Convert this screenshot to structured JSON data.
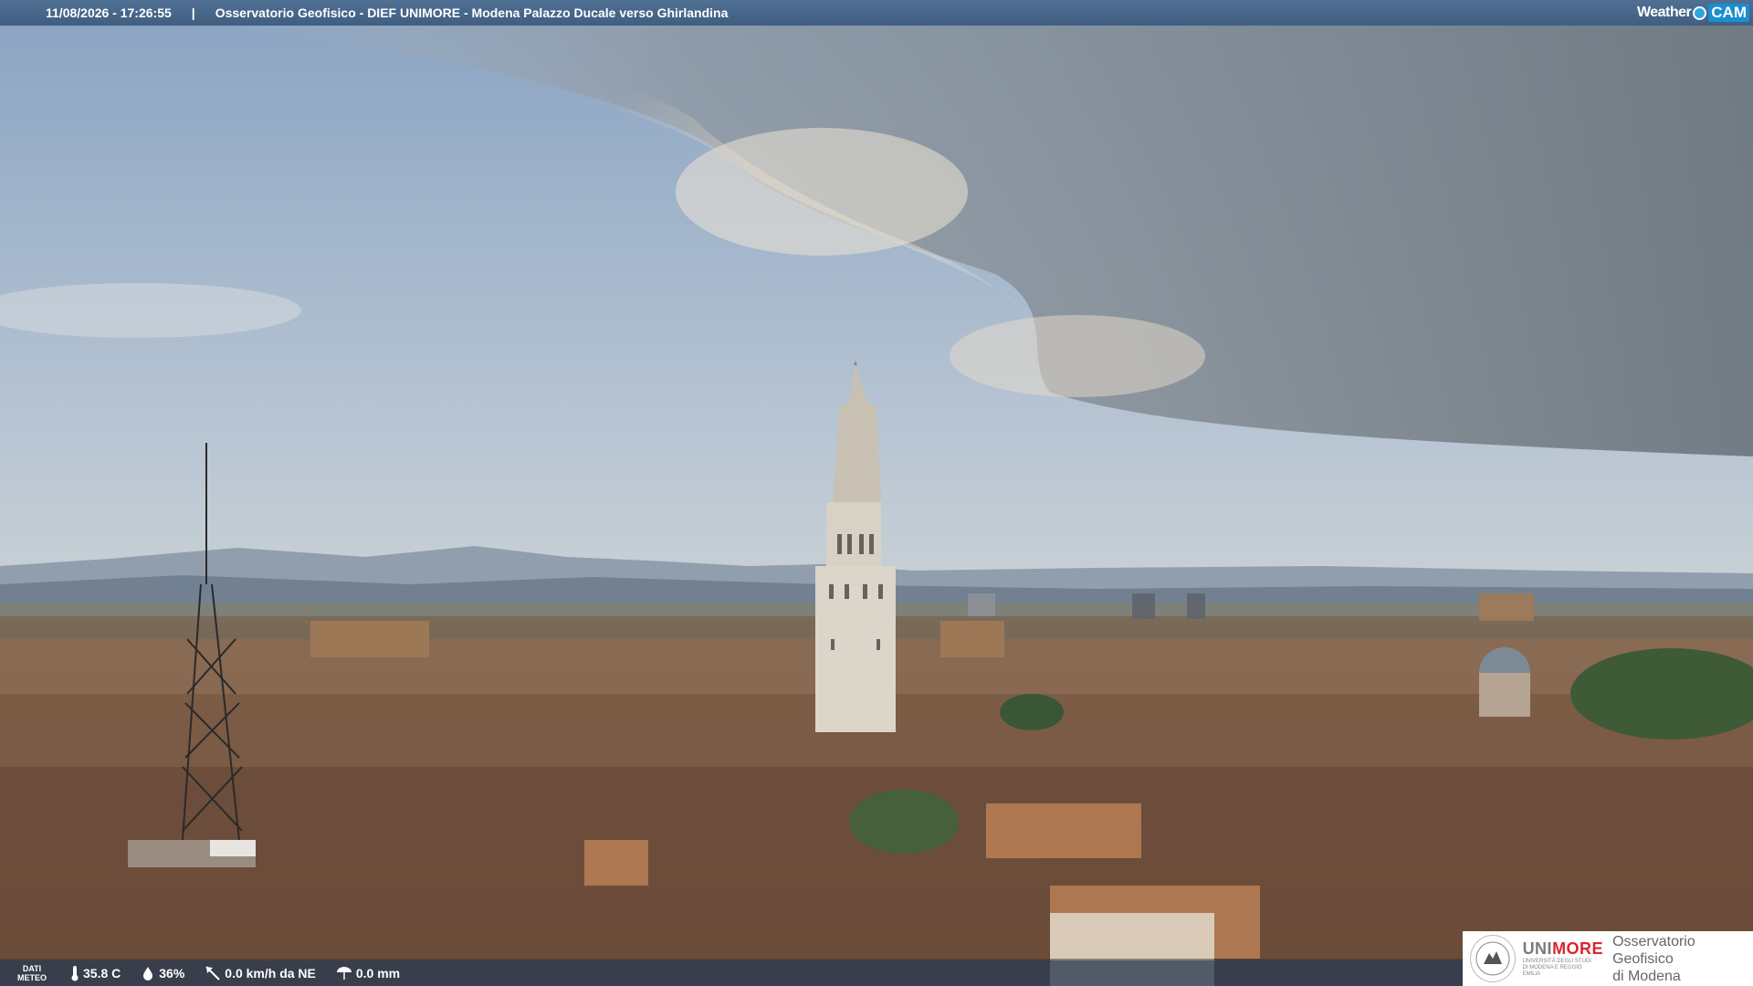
{
  "header": {
    "timestamp": "11/08/2026 - 17:26:55",
    "separator": "|",
    "title": "Osservatorio Geofisico - DIEF UNIMORE - Modena Palazzo Ducale verso Ghirlandina"
  },
  "brand": {
    "weather": "Weather",
    "cam": "CAM"
  },
  "meteo": {
    "label_line1": "DATI",
    "label_line2": "METEO",
    "temperature": "35.8 C",
    "humidity": "36%",
    "wind": "0.0 km/h da NE",
    "rain": "0.0 mm"
  },
  "logo": {
    "uni": "UNI",
    "more": "MORE",
    "university_line": "UNIVERSITÀ DEGLI STUDI DI MODENA E REGGIO EMILIA",
    "observatory_line1": "Osservatorio Geofisico",
    "observatory_line2": "di Modena"
  },
  "colors": {
    "bar": "#456891",
    "unimore_red": "#d9272e",
    "brand_blue": "#1a8fd0"
  }
}
